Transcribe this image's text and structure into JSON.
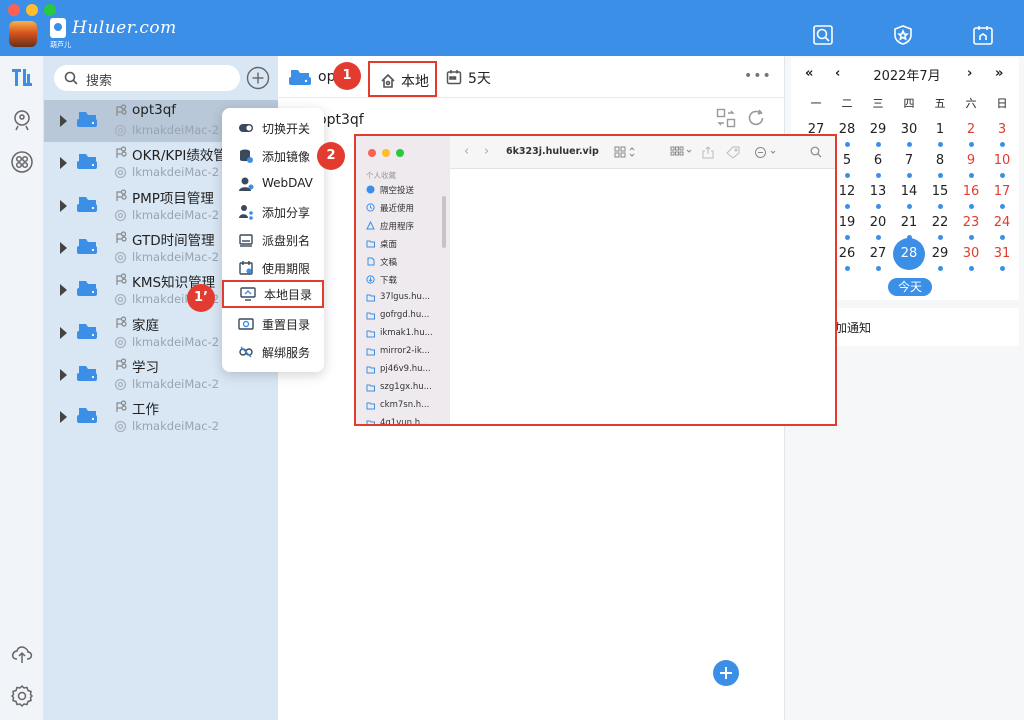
{
  "app": {
    "brand_sub": "葫芦儿",
    "brand_name": "Huluer.com"
  },
  "search": {
    "placeholder": "搜索"
  },
  "disks": [
    {
      "name": "opt3qf",
      "host": "lkmakdeiMac-2",
      "selected": true
    },
    {
      "name": "OKR/KPI绩效管",
      "host": "lkmakdeiMac-2"
    },
    {
      "name": "PMP项目管理",
      "host": "lkmakdeiMac-2"
    },
    {
      "name": "GTD时间管理",
      "host": "lkmakdeiMac-2"
    },
    {
      "name": "KMS知识管理",
      "host": "lkmakdeiMac-2"
    },
    {
      "name": "家庭",
      "host": "lkmakdeiMac-2"
    },
    {
      "name": "学习",
      "host": "lkmakdeiMac-2"
    },
    {
      "name": "工作",
      "host": "lkmakdeiMac-2"
    }
  ],
  "toolbar": {
    "disk_name": "opt",
    "local_label": "本地",
    "days_label": "5天",
    "more": "•••"
  },
  "subtitle": "opt3qf",
  "badges": {
    "b1": "1",
    "b2": "2",
    "b1p": "1’"
  },
  "context_menu": [
    {
      "label": "切换开关",
      "icon": "toggle-icon"
    },
    {
      "label": "添加镜像",
      "icon": "database-icon"
    },
    {
      "label": "WebDAV",
      "icon": "user-icon"
    },
    {
      "label": "添加分享",
      "icon": "share-icon"
    },
    {
      "label": "派盘别名",
      "icon": "drive-alias-icon"
    },
    {
      "label": "使用期限",
      "icon": "calendar-icon"
    },
    {
      "label": "本地目录",
      "icon": "monitor-icon",
      "highlighted": true
    },
    {
      "label": "重置目录",
      "icon": "reset-folder-icon"
    },
    {
      "label": "解绑服务",
      "icon": "unlink-icon"
    }
  ],
  "finder": {
    "title": "6k323j.huluer.vip",
    "section": "个人收藏",
    "items": [
      "隔空投送",
      "最近使用",
      "应用程序",
      "桌面",
      "文稿",
      "下载",
      "37lgus.hu...",
      "gofrgd.hu...",
      "ikmak1.hu...",
      "mirror2-ik...",
      "pj46v9.hu...",
      "szg1gx.hu...",
      "ckm7sn.h...",
      "4g1vun.h..."
    ]
  },
  "calendar": {
    "prev_year": "«",
    "prev_month": "‹",
    "month_label": "2022年7月",
    "next_month": "›",
    "next_year": "»",
    "weekdays": [
      "一",
      "二",
      "三",
      "四",
      "五",
      "六",
      "日"
    ],
    "weeks": [
      [
        "27",
        "28",
        "29",
        "30",
        "1",
        "2",
        "3"
      ],
      [
        "4",
        "5",
        "6",
        "7",
        "8",
        "9",
        "10"
      ],
      [
        "11",
        "12",
        "13",
        "14",
        "15",
        "16",
        "17"
      ],
      [
        "18",
        "19",
        "20",
        "21",
        "22",
        "23",
        "24"
      ],
      [
        "25",
        "26",
        "27",
        "28",
        "29",
        "30",
        "31"
      ]
    ],
    "today_day": "28",
    "today_label": "今天",
    "notice_label": "加通知",
    "weekend_color": "#e23b30",
    "accent_color": "#3c8fe6"
  }
}
